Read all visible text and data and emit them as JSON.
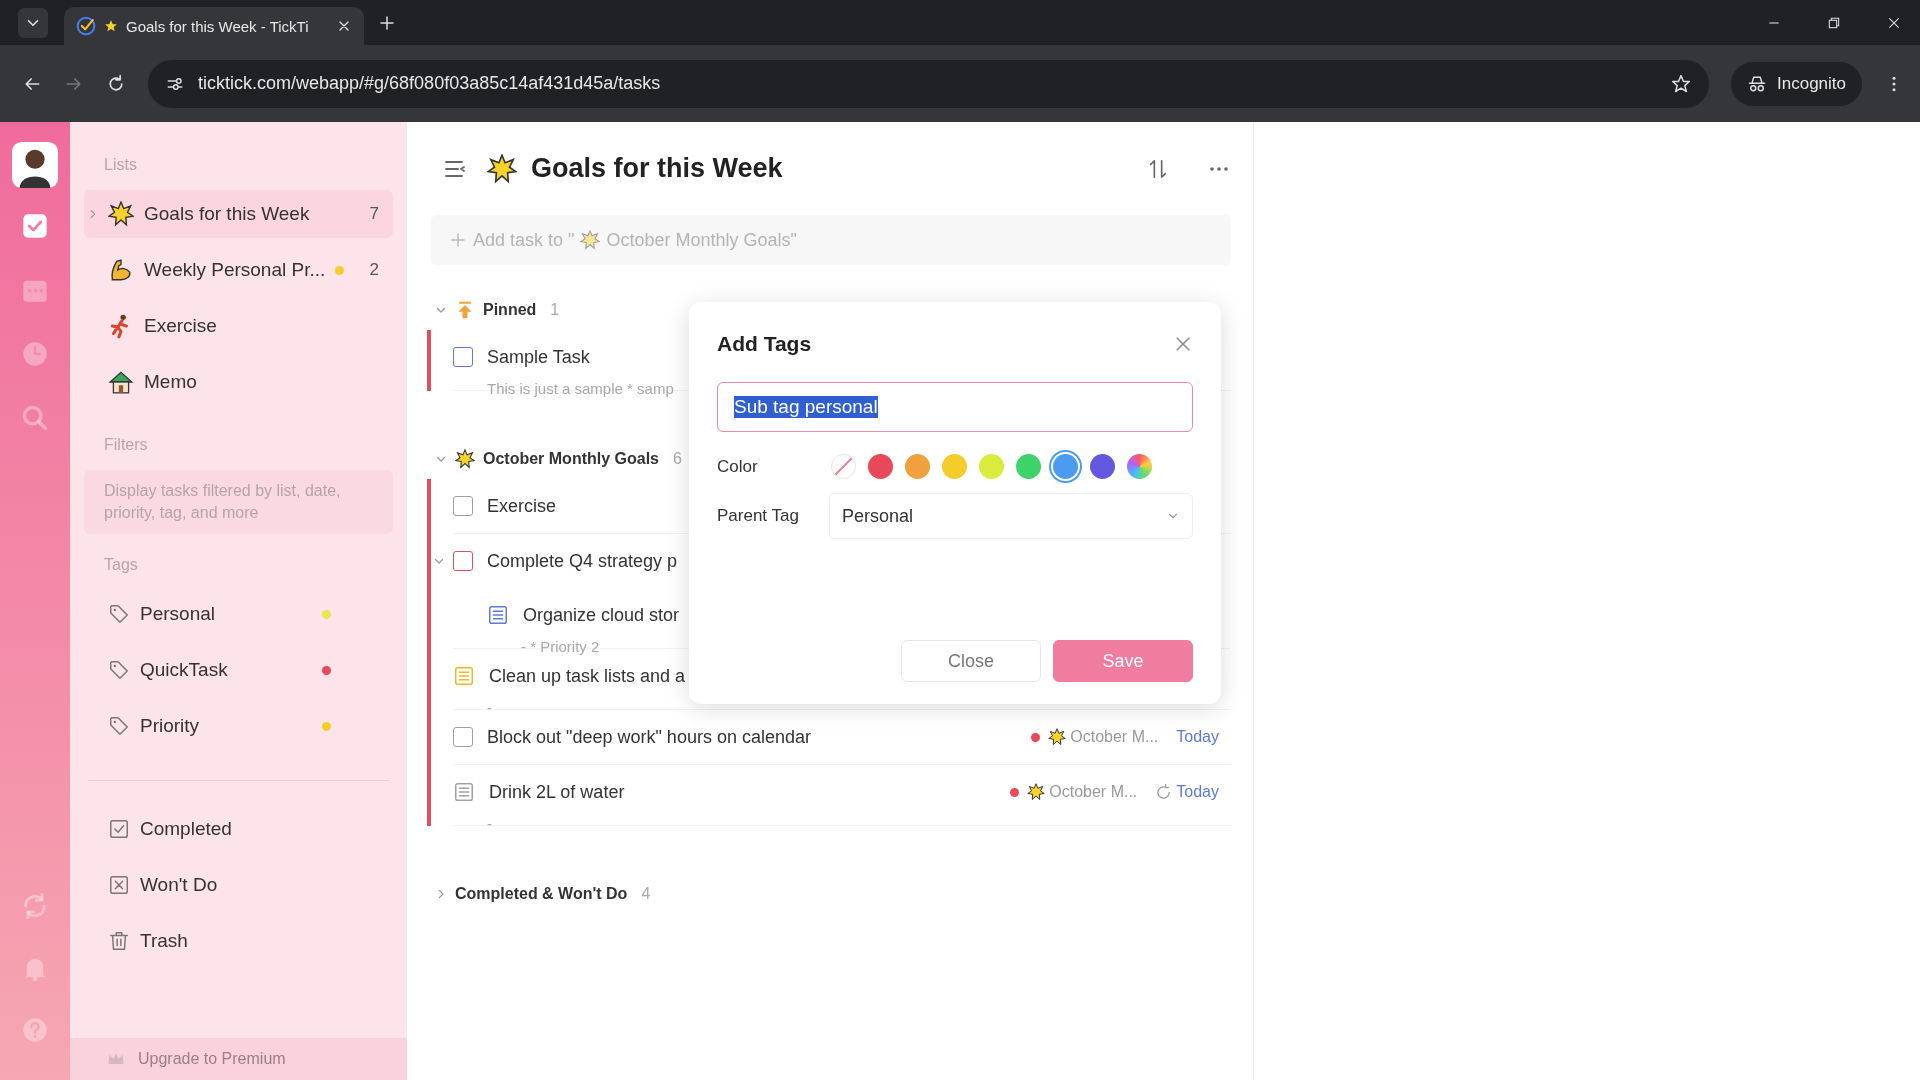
{
  "browser": {
    "tab_title": "Goals for this Week - TickTi",
    "url": "ticktick.com/webapp/#g/68f080f03a85c14af431d45a/tasks",
    "profile": "Incognito"
  },
  "rail": [
    {
      "kind": "tasks",
      "selected": true
    },
    {
      "kind": "calendar",
      "selected": false
    },
    {
      "kind": "clock",
      "selected": false
    },
    {
      "kind": "search",
      "selected": false
    },
    {
      "kind": "sync",
      "selected": false
    },
    {
      "kind": "bell",
      "selected": false
    },
    {
      "kind": "help",
      "selected": false
    }
  ],
  "sidebar": {
    "lists_heading": "Lists",
    "lists": [
      {
        "name": "Goals for this Week",
        "count": "7",
        "selected": true
      },
      {
        "name": "Weekly Personal Pr...",
        "count": "2",
        "selected": false,
        "color": "#f5cd2a"
      },
      {
        "name": "Exercise",
        "selected": false
      },
      {
        "name": "Memo",
        "selected": false
      }
    ],
    "filters_heading": "Filters",
    "filters_hint": "Display tasks filtered by list, date, priority, tag, and more",
    "tags_heading": "Tags",
    "tags": [
      {
        "name": "Personal",
        "color": "#e8e84a"
      },
      {
        "name": "QuickTask",
        "color": "#e9485a"
      },
      {
        "name": "Priority",
        "color": "#f5cd2a"
      }
    ],
    "system": [
      {
        "kind": "completed",
        "name": "Completed"
      },
      {
        "kind": "wontdo",
        "name": "Won't Do"
      },
      {
        "kind": "trash",
        "name": "Trash"
      }
    ],
    "upgrade": "Upgrade to Premium"
  },
  "main": {
    "title": "Goals for this Week",
    "add_task_start": "Add task to \"",
    "add_task_end": "October Monthly Goals\"",
    "sections": [
      {
        "title": "Pinned",
        "count": "1",
        "expanded": true,
        "tasks": [
          {
            "kind": "checkbox",
            "color": "#5b7bd5",
            "title": "Sample Task",
            "note": "This is just a sample * samp"
          }
        ]
      },
      {
        "title": "October Monthly Goals",
        "count": "6",
        "expanded": true,
        "tasks": [
          {
            "kind": "checkbox",
            "color": "#a0a0a0",
            "title": "Exercise"
          },
          {
            "kind": "checkbox",
            "color": "#e0505a",
            "title": "Complete Q4 strategy p",
            "expanded": true,
            "children": [
              {
                "kind": "note",
                "color": "#5b7bd5",
                "title": "Organize cloud stor",
                "note": "- * Priority 2"
              }
            ]
          },
          {
            "kind": "note",
            "color": "#f0b429",
            "title": "Clean up task lists and a",
            "note": "-"
          },
          {
            "kind": "checkbox",
            "color": "#a0a0a0",
            "title": "Block out \"deep work\" hours on calendar",
            "meta": {
              "color": "#e9485a",
              "list": "October M...",
              "repeat": false,
              "date": "Today"
            }
          },
          {
            "kind": "note",
            "color": "#a0a0a0",
            "title": "Drink 2L of water",
            "note": "-",
            "meta": {
              "color": "#e9485a",
              "list": "October M...",
              "repeat": true,
              "date": "Today"
            }
          }
        ]
      },
      {
        "title": "Completed & Won't Do",
        "count": "4",
        "expanded": false
      }
    ]
  },
  "dialog": {
    "title": "Add Tags",
    "name_value": "Sub tag personal",
    "name_selected": true,
    "color_label": "Color",
    "swatches": [
      {
        "kind": "none",
        "selected": false
      },
      {
        "kind": "solid",
        "color": "#e9485a",
        "selected": false
      },
      {
        "kind": "solid",
        "color": "#f0a03c",
        "selected": false
      },
      {
        "kind": "solid",
        "color": "#f5cd2a",
        "selected": false
      },
      {
        "kind": "solid",
        "color": "#d9ec3d",
        "selected": false
      },
      {
        "kind": "solid",
        "color": "#3ed26a",
        "selected": false
      },
      {
        "kind": "solid",
        "color": "#4b9bf0",
        "selected": true
      },
      {
        "kind": "solid",
        "color": "#6457e0",
        "selected": false
      },
      {
        "kind": "gradient",
        "selected": false
      }
    ],
    "parent_label": "Parent Tag",
    "parent_value": "Personal",
    "buttons": [
      {
        "kind": "secondary",
        "label": "Close"
      },
      {
        "kind": "primary",
        "label": "Save"
      }
    ]
  }
}
